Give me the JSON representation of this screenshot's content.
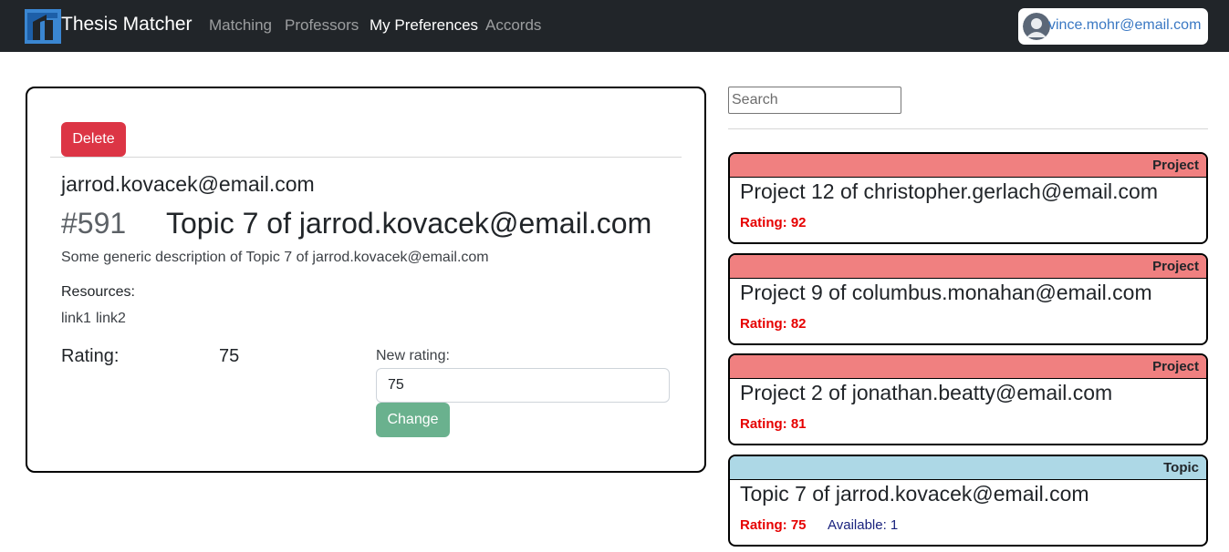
{
  "app": {
    "brand": "Thesis Matcher"
  },
  "nav": {
    "items": [
      {
        "label": "Matching",
        "active": false
      },
      {
        "label": "Professors",
        "active": false
      },
      {
        "label": "My Preferences",
        "active": true
      },
      {
        "label": "Accords",
        "active": false
      }
    ]
  },
  "user": {
    "email": "vince.mohr@email.com",
    "avatar_icon": "user-avatar-icon"
  },
  "detail": {
    "delete_label": "Delete",
    "owner_email": "jarrod.kovacek@email.com",
    "id": "#591",
    "title": "Topic 7 of jarrod.kovacek@email.com",
    "description": "Some generic description of Topic 7 of jarrod.kovacek@email.com",
    "resources_label": "Resources:",
    "links": [
      "link1",
      "link2"
    ],
    "rating_label": "Rating:",
    "rating_value": "75",
    "new_rating_label": "New rating:",
    "new_rating_value": "75",
    "change_label": "Change"
  },
  "search": {
    "placeholder": "Search"
  },
  "cards": [
    {
      "type": "Project",
      "title": "Project 12 of christopher.gerlach@email.com",
      "rating": "Rating: 92",
      "available": ""
    },
    {
      "type": "Project",
      "title": "Project 9 of columbus.monahan@email.com",
      "rating": "Rating: 82",
      "available": ""
    },
    {
      "type": "Project",
      "title": "Project 2 of jonathan.beatty@email.com",
      "rating": "Rating: 81",
      "available": ""
    },
    {
      "type": "Topic",
      "title": "Topic 7 of jarrod.kovacek@email.com",
      "rating": "Rating: 75",
      "available": "Available: 1"
    }
  ],
  "colors": {
    "navbar": "#212529",
    "delete": "#dc3545",
    "change": "#6ab18e",
    "project_header": "#f08080",
    "topic_header": "#add8e6",
    "rating_text": "#e60000",
    "available_text": "#1a237e"
  }
}
